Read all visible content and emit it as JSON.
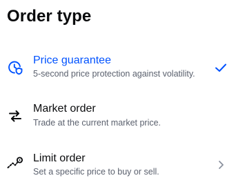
{
  "page": {
    "title": "Order type"
  },
  "options": [
    {
      "title": "Price guarantee",
      "subtitle": "5-second price protection against volatility.",
      "icon": "shield-clock-icon",
      "selected": true,
      "trailing_icon": "checkmark-icon"
    },
    {
      "title": "Market order",
      "subtitle": "Trade at the current market price.",
      "icon": "swap-arrows-icon",
      "selected": false,
      "trailing_icon": null
    },
    {
      "title": "Limit order",
      "subtitle": "Set a specific price to buy or sell.",
      "icon": "target-trend-icon",
      "selected": false,
      "trailing_icon": "chevron-right-icon"
    }
  ],
  "colors": {
    "accent": "#0052ff",
    "text_primary": "#0a0b0d",
    "text_secondary": "#5b616e",
    "chevron": "#8a919e"
  }
}
